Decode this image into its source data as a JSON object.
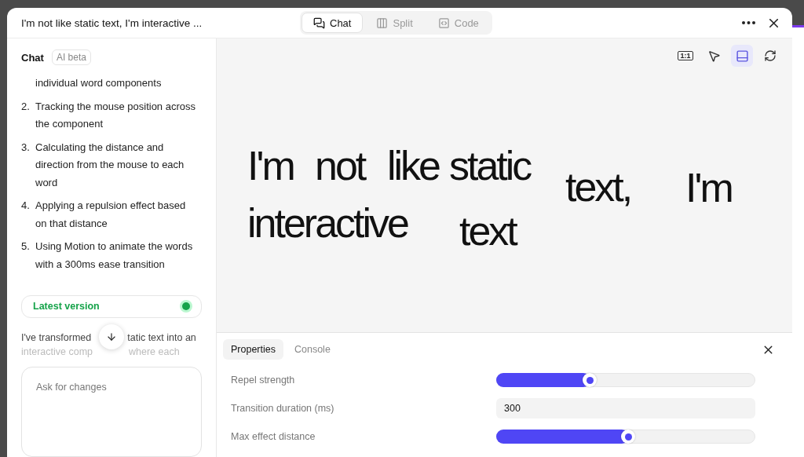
{
  "window": {
    "title": "I'm not like static text, I'm interactive ..."
  },
  "view_tabs": [
    {
      "label": "Chat",
      "selected": true
    },
    {
      "label": "Split",
      "selected": false
    },
    {
      "label": "Code",
      "selected": false
    }
  ],
  "chat": {
    "title": "Chat",
    "badge": "AI beta",
    "steps": [
      {
        "text": "individual word components"
      },
      {
        "number": "2.",
        "text": "Tracking the mouse position across the component"
      },
      {
        "number": "3.",
        "text": "Calculating the distance and direction from the mouse to each word"
      },
      {
        "number": "4.",
        "text": "Applying a repulsion effect based on that distance"
      },
      {
        "number": "5.",
        "text": "Using Motion to animate the words with a 300ms ease transition"
      }
    ],
    "version": {
      "label": "Latest version",
      "active": true
    },
    "message_lines": [
      [
        "I've transformed",
        "tatic text into an"
      ],
      [
        "interactive comp",
        "where each"
      ]
    ],
    "input": {
      "placeholder": "Ask for changes"
    }
  },
  "preview_toolbar": [
    {
      "kind": "ratio",
      "label": "1:1",
      "selected": false
    },
    {
      "kind": "select",
      "selected": false
    },
    {
      "kind": "panel",
      "selected": true
    },
    {
      "kind": "refresh",
      "selected": false
    }
  ],
  "preview_words": [
    "I'm",
    "not",
    "like",
    "static",
    "text,",
    "I'm",
    "interactive",
    "text"
  ],
  "panel": {
    "tabs": [
      {
        "label": "Properties",
        "selected": true
      },
      {
        "label": "Console",
        "selected": false
      }
    ],
    "properties": [
      {
        "kind": "slider",
        "label": "Repel strength",
        "level": 0.36
      },
      {
        "kind": "number",
        "label": "Transition duration (ms)",
        "value": "300"
      },
      {
        "kind": "slider",
        "label": "Max effect distance",
        "level": 0.51
      }
    ]
  }
}
